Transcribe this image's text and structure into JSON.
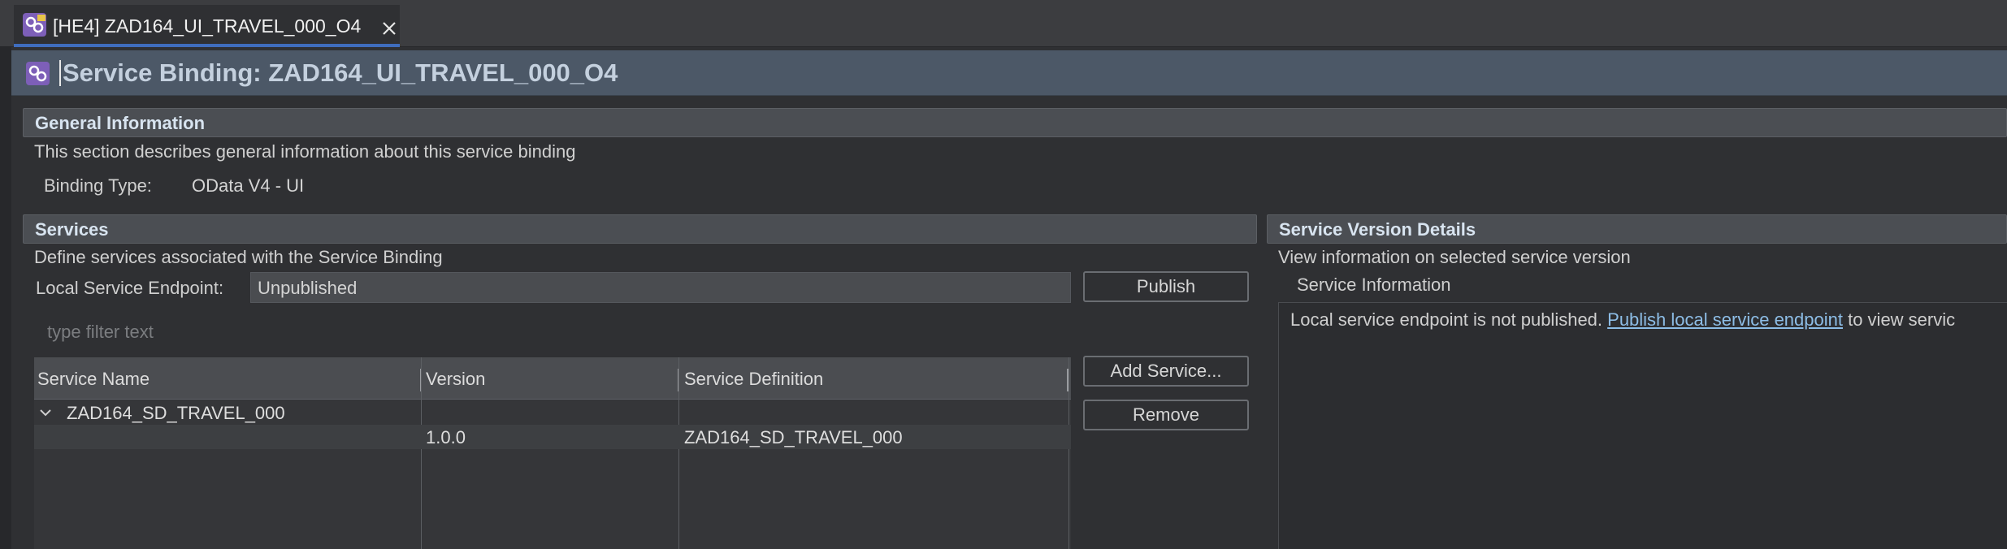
{
  "tab": {
    "label": "[HE4] ZAD164_UI_TRAVEL_000_O4",
    "icon": "service-binding-icon",
    "close_icon": "close-icon"
  },
  "header": {
    "title": "Service Binding: ZAD164_UI_TRAVEL_000_O4",
    "icon": "service-binding-icon"
  },
  "general": {
    "title": "General Information",
    "description": "This section describes general information about this service binding",
    "binding_type_label": "Binding Type:",
    "binding_type_value": "OData V4 - UI"
  },
  "services": {
    "title": "Services",
    "description": "Define services associated with the Service Binding",
    "endpoint_label": "Local Service Endpoint:",
    "endpoint_value": "Unpublished",
    "publish_label": "Publish",
    "filter_placeholder": "type filter text",
    "add_service_label": "Add Service...",
    "remove_label": "Remove",
    "columns": [
      "Service Name",
      "Version",
      "Service Definition"
    ],
    "rows": [
      {
        "name": "ZAD164_SD_TRAVEL_000",
        "version": "",
        "definition": ""
      },
      {
        "name": "",
        "version": "1.0.0",
        "definition": "ZAD164_SD_TRAVEL_000"
      }
    ]
  },
  "version_details": {
    "title": "Service Version Details",
    "description": "View information on selected service version",
    "info_label": "Service Information",
    "message_prefix": "Local service endpoint is not published. ",
    "message_link": "Publish local service endpoint",
    "message_suffix": " to view servic"
  },
  "colors": {
    "accent": "#3f6dbd",
    "header_bg": "#4c5867",
    "link": "#8dbde6"
  }
}
